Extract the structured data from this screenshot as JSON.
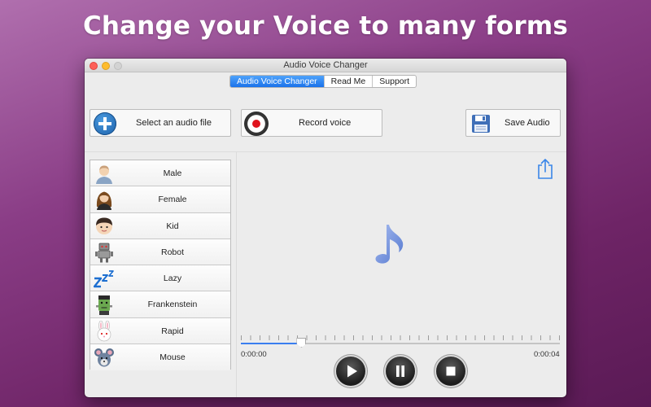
{
  "headline": "Change your Voice to many forms",
  "window": {
    "title": "Audio Voice Changer"
  },
  "tabs": [
    {
      "label": "Audio Voice Changer",
      "active": true
    },
    {
      "label": "Read Me",
      "active": false
    },
    {
      "label": "Support",
      "active": false
    }
  ],
  "toolbar": {
    "select_label": "Select an audio file",
    "record_label": "Record voice",
    "save_label": "Save Audio"
  },
  "effects": [
    {
      "label": "Male",
      "icon": "male-avatar-icon"
    },
    {
      "label": "Female",
      "icon": "female-avatar-icon"
    },
    {
      "label": "Kid",
      "icon": "kid-avatar-icon"
    },
    {
      "label": "Robot",
      "icon": "robot-icon"
    },
    {
      "label": "Lazy",
      "icon": "zzz-icon"
    },
    {
      "label": "Frankenstein",
      "icon": "frankenstein-icon"
    },
    {
      "label": "Rapid",
      "icon": "rabbit-icon"
    },
    {
      "label": "Mouse",
      "icon": "mouse-icon"
    }
  ],
  "player": {
    "current_time": "0:00:00",
    "total_time": "0:00:04",
    "position_fraction": 0.19
  },
  "colors": {
    "accent": "#1a72ea",
    "record": "#e0141e",
    "note": "#6f8fdc"
  }
}
